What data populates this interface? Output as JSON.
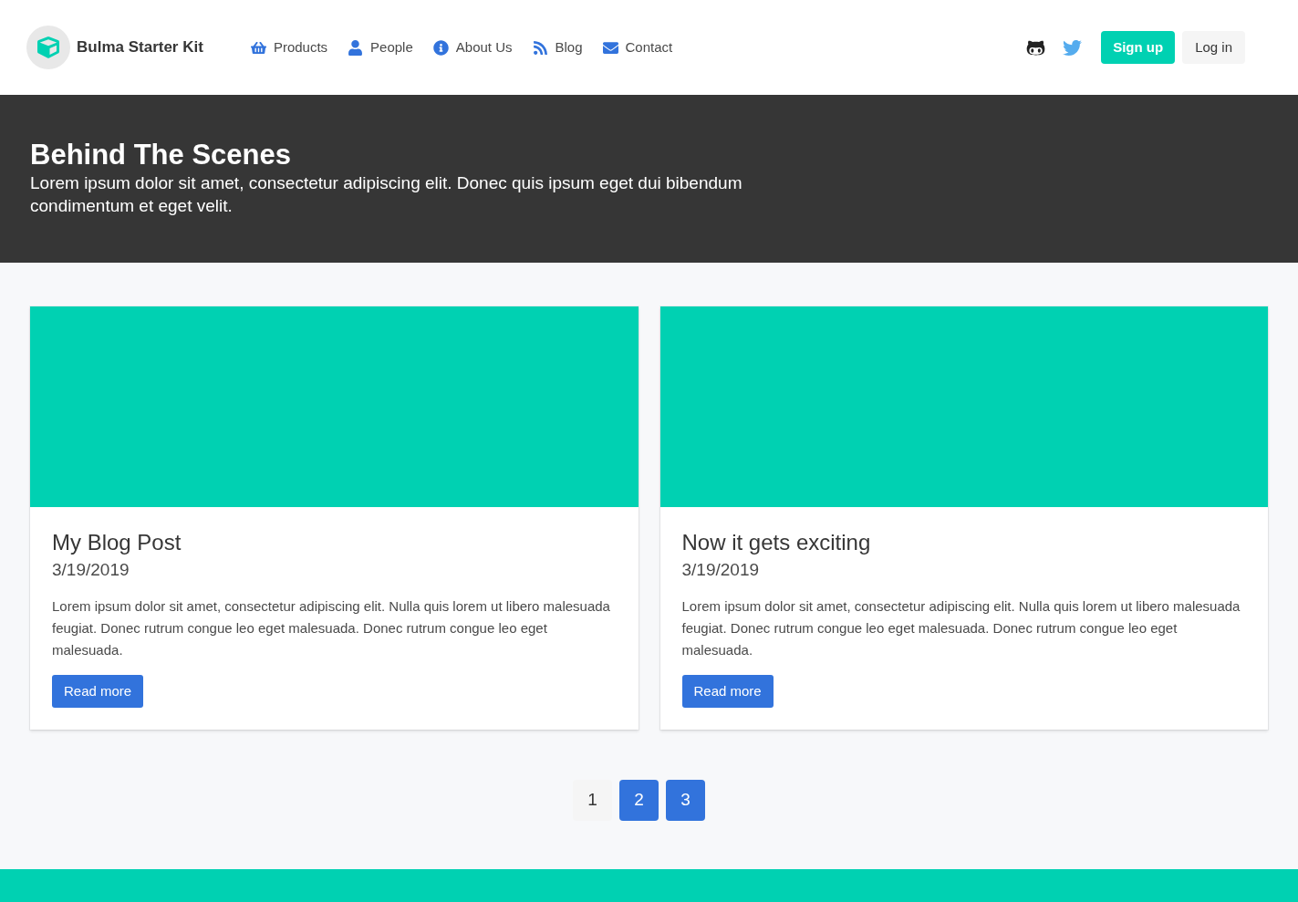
{
  "navbar": {
    "brand": "Bulma Starter Kit",
    "links": [
      {
        "label": "Products",
        "kind": "basket"
      },
      {
        "label": "People",
        "kind": "person"
      },
      {
        "label": "About Us",
        "kind": "info"
      },
      {
        "label": "Blog",
        "kind": "rss"
      },
      {
        "label": "Contact",
        "kind": "mail"
      }
    ],
    "signup": "Sign up",
    "login": "Log in"
  },
  "hero": {
    "title": "Behind The Scenes",
    "subtitle": "Lorem ipsum dolor sit amet, consectetur adipiscing elit. Donec quis ipsum eget dui bibendum condimentum et eget velit."
  },
  "posts": [
    {
      "title": "My Blog Post",
      "date": "3/19/2019",
      "body": "Lorem ipsum dolor sit amet, consectetur adipiscing elit. Nulla quis lorem ut libero malesuada feugiat. Donec rutrum congue leo eget malesuada. Donec rutrum congue leo eget malesuada.",
      "button": "Read more"
    },
    {
      "title": "Now it gets exciting",
      "date": "3/19/2019",
      "body": "Lorem ipsum dolor sit amet, consectetur adipiscing elit. Nulla quis lorem ut libero malesuada feugiat. Donec rutrum congue leo eget malesuada. Donec rutrum congue leo eget malesuada.",
      "button": "Read more"
    }
  ],
  "pagination": [
    {
      "label": "1",
      "selected": true
    },
    {
      "label": "2",
      "selected": false
    },
    {
      "label": "3",
      "selected": false
    }
  ]
}
